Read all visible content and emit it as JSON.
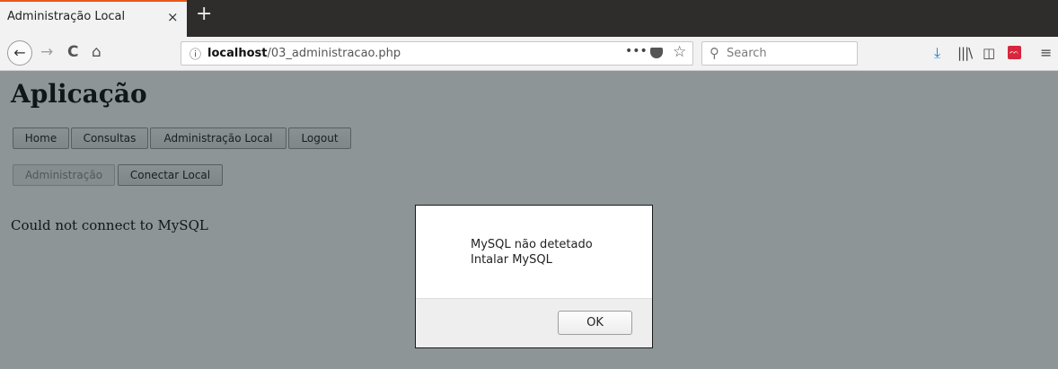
{
  "browser": {
    "tab_title": "Administração Local",
    "tab_close": "×",
    "new_tab": "+",
    "back": "←",
    "forward": "→",
    "reload": "C",
    "home": "⌂",
    "url_host": "localhost",
    "url_path": "/03_administracao.php",
    "url_more": "•••",
    "search_placeholder": "Search"
  },
  "page": {
    "title": "Aplicação",
    "nav_buttons": [
      "Home",
      "Consultas",
      "Administração Local",
      "Logout"
    ],
    "sub_buttons": [
      "Administração",
      "Conectar Local"
    ],
    "error_text": "Could not connect to MySQL"
  },
  "dialog": {
    "line1": "MySQL não detetado",
    "line2": "Intalar MySQL",
    "ok_label": "OK"
  },
  "colors": {
    "tab_accent": "#e8591a",
    "tabstrip": "#2e2d2b",
    "overlay": "rgba(13,30,34,0.47)",
    "download_icon": "#1f7ad6",
    "extension_icon": "#d7263d"
  }
}
